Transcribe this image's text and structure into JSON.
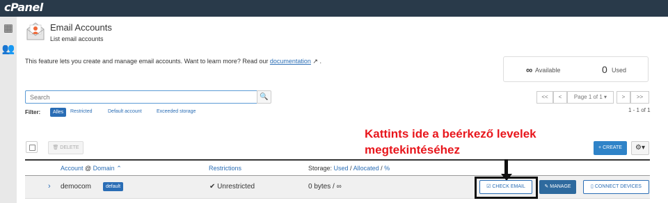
{
  "app": {
    "logo": "cPanel"
  },
  "header": {
    "title": "Email Accounts",
    "subtitle": "List email accounts"
  },
  "intro": {
    "text": "This feature lets you create and manage email accounts. Want to learn more? Read our ",
    "link": "documentation",
    "link_suffix": " ↗ ."
  },
  "stats": {
    "available_symbol": "∞",
    "available_label": "Available",
    "used_value": "0",
    "used_label": "Used"
  },
  "search": {
    "placeholder": "Search"
  },
  "pagination": {
    "first": "<<",
    "prev": "<",
    "page_label": "Page 1 of 1 ▾",
    "next": ">",
    "last": ">>",
    "count": "1 - 1 of 1"
  },
  "filter": {
    "label": "Filter:",
    "active": "Alles",
    "options": [
      "Restricted",
      "Default account",
      "Exceeded storage"
    ]
  },
  "toolbar": {
    "delete_label": "🗑 DELETE",
    "create_label": "+ CREATE",
    "gear_label": "⚙▾"
  },
  "annotation": {
    "line1": "Kattints ide a beérkező levelek",
    "line2": "megtekintéséhez"
  },
  "table": {
    "headers": {
      "account": "Account",
      "at": " @ ",
      "domain": "Domain",
      "sort": " ⌃",
      "restrictions": "Restrictions",
      "storage_prefix": "Storage: ",
      "used": "Used",
      "sep1": " / ",
      "allocated": "Allocated",
      "sep2": " / ",
      "percent": "%"
    },
    "rows": [
      {
        "account": "democom",
        "badge": "default",
        "restrictions": "✔ Unrestricted",
        "storage": "0 bytes / ∞"
      }
    ],
    "actions": {
      "check_email": "☑ CHECK EMAIL",
      "manage": "✎ MANAGE",
      "connect": "▯ CONNECT DEVICES"
    }
  },
  "colors": {
    "topbar": "#293a4a",
    "accent": "#2a6db5",
    "annotation": "#e8161c"
  }
}
